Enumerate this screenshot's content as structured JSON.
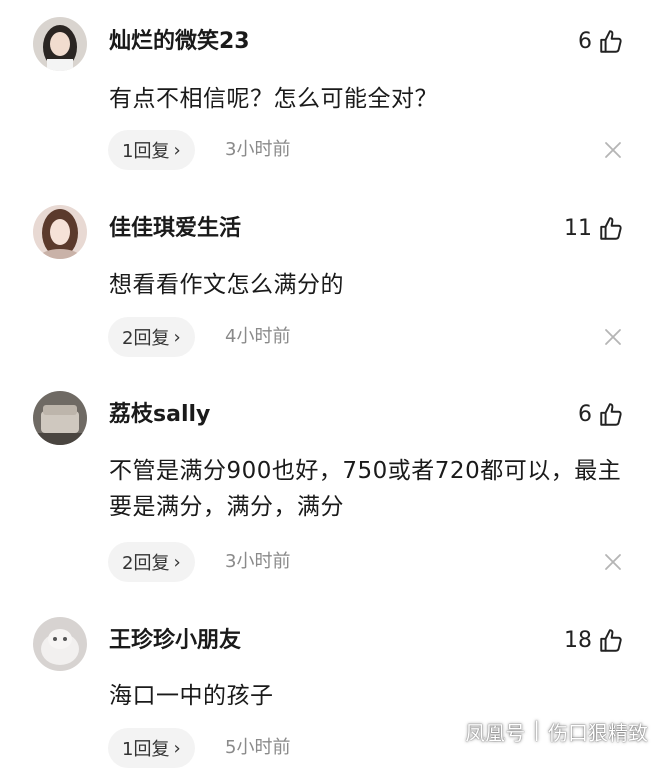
{
  "comments": [
    {
      "username": "灿烂的微笑23",
      "likes": "6",
      "text": "有点不相信呢？怎么可能全对？",
      "replies": "1回复",
      "time": "3小时前"
    },
    {
      "username": "佳佳琪爱生活",
      "likes": "11",
      "text": "想看看作文怎么满分的",
      "replies": "2回复",
      "time": "4小时前"
    },
    {
      "username": "荔枝sally",
      "likes": "6",
      "text": "不管是满分900也好，750或者720都可以，最主要是满分，满分，满分",
      "replies": "2回复",
      "time": "3小时前"
    },
    {
      "username": "王珍珍小朋友",
      "likes": "18",
      "text": "海口一中的孩子",
      "replies": "1回复",
      "time": "5小时前"
    }
  ],
  "reply_chevron": "›",
  "watermark": {
    "source": "凤凰号",
    "author": "伤口狠精致"
  },
  "icons": {
    "like": "thumbs-up-icon",
    "close": "close-icon"
  },
  "colors": {
    "text": "#1a1a1a",
    "muted": "#8a8a8a",
    "pill_bg": "#f3f3f3"
  }
}
